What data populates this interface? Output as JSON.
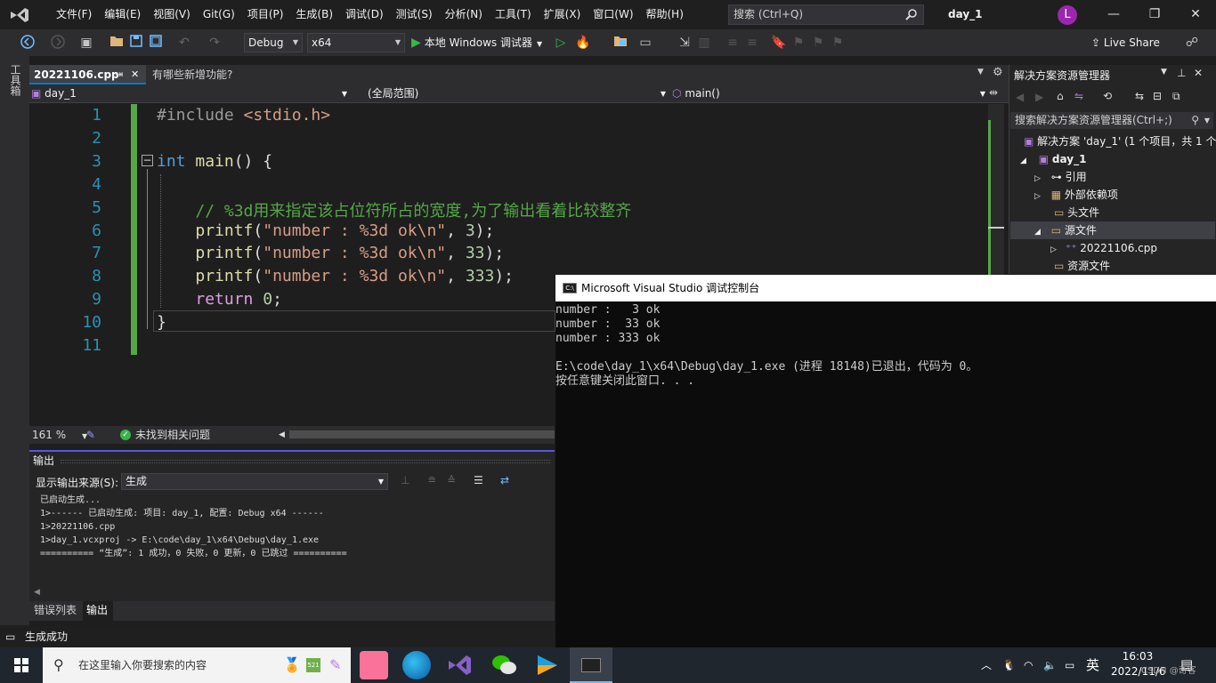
{
  "menu": [
    "文件(F)",
    "编辑(E)",
    "视图(V)",
    "Git(G)",
    "项目(P)",
    "生成(B)",
    "调试(D)",
    "测试(S)",
    "分析(N)",
    "工具(T)",
    "扩展(X)",
    "窗口(W)",
    "帮助(H)"
  ],
  "search": {
    "placeholder": "搜索 (Ctrl+Q)"
  },
  "solution_name": "day_1",
  "avatar_letter": "L",
  "toolbar": {
    "config": "Debug",
    "platform": "x64",
    "run_label": "本地 Windows 调试器",
    "live_share": "Live Share"
  },
  "left_strip_label": "工具箱",
  "tabs": [
    {
      "label": "20221106.cpp",
      "pin": "⇥",
      "close": "✕"
    },
    {
      "label": "有哪些新增功能?"
    }
  ],
  "navbar": {
    "project": "day_1",
    "scope": "(全局范围)",
    "member": "main()"
  },
  "code": {
    "line_numbers": [
      "1",
      "2",
      "3",
      "4",
      "5",
      "6",
      "7",
      "8",
      "9",
      "10",
      "11"
    ]
  },
  "editor_status": {
    "zoom": "161 %",
    "issues": "未找到相关问题"
  },
  "output": {
    "title": "输出",
    "source_label": "显示输出来源(S):",
    "source_value": "生成",
    "lines": [
      "已启动生成...",
      "1>------ 已启动生成: 项目: day_1, 配置: Debug x64 ------",
      "1>20221106.cpp",
      "1>day_1.vcxproj -> E:\\code\\day_1\\x64\\Debug\\day_1.exe",
      "========== “生成”: 1 成功，0 失败，0 更新，0 已跳过 =========="
    ]
  },
  "bottom_tabs": [
    "错误列表",
    "输出"
  ],
  "status_bar": "生成成功",
  "solution_explorer": {
    "title": "解决方案资源管理器",
    "search_placeholder": "搜索解决方案资源管理器(Ctrl+;)",
    "items": [
      {
        "label": "解决方案 'day_1' (1 个项目，共 1 个"
      },
      {
        "label": "day_1"
      },
      {
        "label": "引用"
      },
      {
        "label": "外部依赖项"
      },
      {
        "label": "头文件"
      },
      {
        "label": "源文件"
      },
      {
        "label": "20221106.cpp"
      },
      {
        "label": "资源文件"
      }
    ]
  },
  "console": {
    "title": "Microsoft Visual Studio 调试控制台",
    "lines": [
      "number :   3 ok",
      "number :  33 ok",
      "number : 333 ok",
      "",
      "E:\\code\\day_1\\x64\\Debug\\day_1.exe (进程 18148)已退出，代码为 0。",
      "按任意键关闭此窗口. . ."
    ]
  },
  "taskbar": {
    "search_placeholder": "在这里输入你要搜索的内容",
    "ime": "英",
    "time": "16:03",
    "date": "2022/11/6",
    "watermark": "CSDN @奇客"
  }
}
